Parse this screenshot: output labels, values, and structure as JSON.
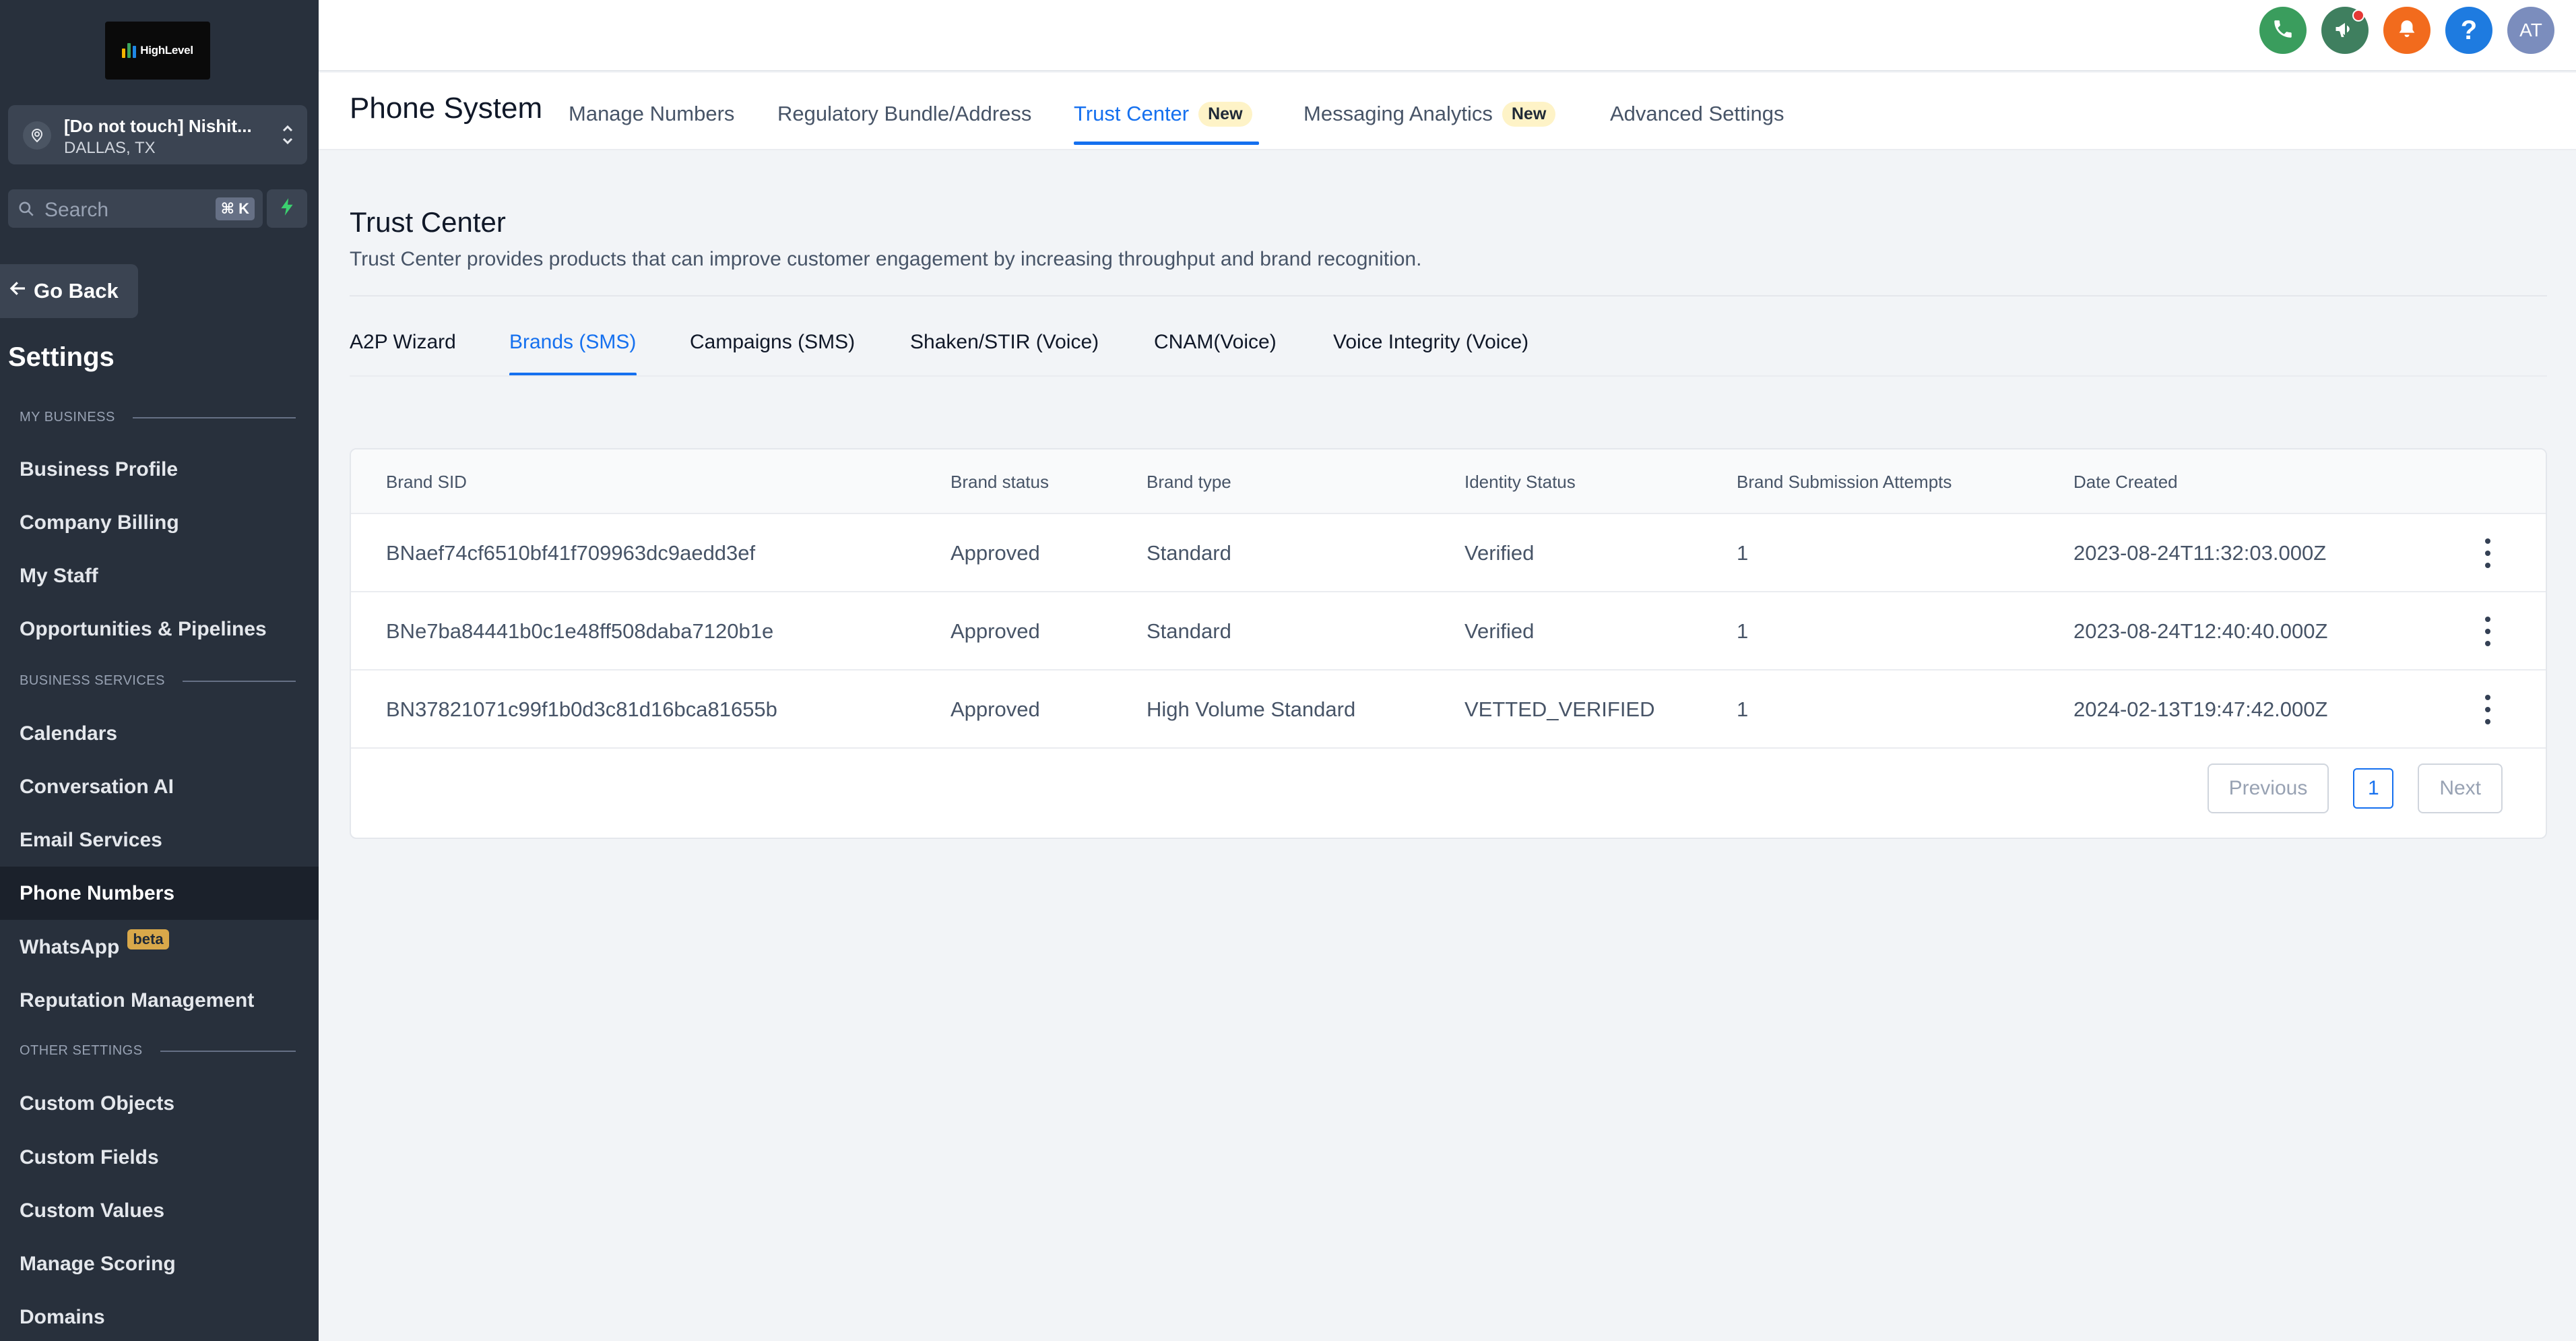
{
  "brand": {
    "logo_text": "HighLevel",
    "logo_bar_colors": [
      "#f5b400",
      "#3ba55d",
      "#1e88e5"
    ]
  },
  "account": {
    "name": "[Do not touch] Nishit...",
    "location": "DALLAS, TX"
  },
  "search": {
    "placeholder": "Search",
    "shortcut": "⌘ K"
  },
  "sidebar": {
    "go_back": "Go Back",
    "title": "Settings",
    "sections": [
      {
        "heading": "MY BUSINESS",
        "items": [
          {
            "label": "Business Profile"
          },
          {
            "label": "Company Billing"
          },
          {
            "label": "My Staff"
          },
          {
            "label": "Opportunities & Pipelines"
          }
        ]
      },
      {
        "heading": "BUSINESS SERVICES",
        "items": [
          {
            "label": "Calendars"
          },
          {
            "label": "Conversation AI"
          },
          {
            "label": "Email Services"
          },
          {
            "label": "Phone Numbers",
            "active": true
          },
          {
            "label": "WhatsApp",
            "badge": "beta"
          },
          {
            "label": "Reputation Management"
          }
        ]
      },
      {
        "heading": "OTHER SETTINGS",
        "items": [
          {
            "label": "Custom Objects"
          },
          {
            "label": "Custom Fields"
          },
          {
            "label": "Custom Values"
          },
          {
            "label": "Manage Scoring"
          },
          {
            "label": "Domains"
          }
        ]
      }
    ]
  },
  "topbar": {
    "icons": [
      {
        "name": "phone-icon",
        "color": "#3a9d5d"
      },
      {
        "name": "megaphone-icon",
        "color": "#3f7f5f",
        "has_dot": true
      },
      {
        "name": "bell-icon",
        "color": "#f26b1d"
      },
      {
        "name": "help-icon",
        "color": "#1e7be0"
      }
    ],
    "avatar_initials": "AT",
    "avatar_color": "#7b8dbd"
  },
  "header": {
    "title": "Phone System",
    "tabs": [
      {
        "label": "Manage Numbers"
      },
      {
        "label": "Regulatory Bundle/Address"
      },
      {
        "label": "Trust Center",
        "badge": "New",
        "active": true
      },
      {
        "label": "Messaging Analytics",
        "badge": "New"
      },
      {
        "label": "Advanced Settings"
      }
    ]
  },
  "trust_center": {
    "title": "Trust Center",
    "description": "Trust Center provides products that can improve customer engagement by increasing throughput and brand recognition.",
    "tabs": [
      {
        "label": "A2P Wizard"
      },
      {
        "label": "Brands (SMS)",
        "active": true
      },
      {
        "label": "Campaigns (SMS)"
      },
      {
        "label": "Shaken/STIR (Voice)"
      },
      {
        "label": "CNAM(Voice)"
      },
      {
        "label": "Voice Integrity (Voice)"
      }
    ]
  },
  "table": {
    "columns": [
      "Brand SID",
      "Brand status",
      "Brand type",
      "Identity Status",
      "Brand Submission Attempts",
      "Date Created"
    ],
    "rows": [
      [
        "BNaef74cf6510bf41f709963dc9aedd3ef",
        "Approved",
        "Standard",
        "Verified",
        "1",
        "2023-08-24T11:32:03.000Z"
      ],
      [
        "BNe7ba84441b0c1e48ff508daba7120b1e",
        "Approved",
        "Standard",
        "Verified",
        "1",
        "2023-08-24T12:40:40.000Z"
      ],
      [
        "BN37821071c99f1b0d3c81d16bca81655b",
        "Approved",
        "High Volume Standard",
        "VETTED_VERIFIED",
        "1",
        "2024-02-13T19:47:42.000Z"
      ]
    ]
  },
  "pagination": {
    "previous": "Previous",
    "current_page": "1",
    "next": "Next"
  },
  "colors": {
    "accent": "#1570ef",
    "sidebar_bg": "#28303c",
    "new_badge_bg": "#fef3c7",
    "beta_badge_bg": "#d9a84a"
  }
}
